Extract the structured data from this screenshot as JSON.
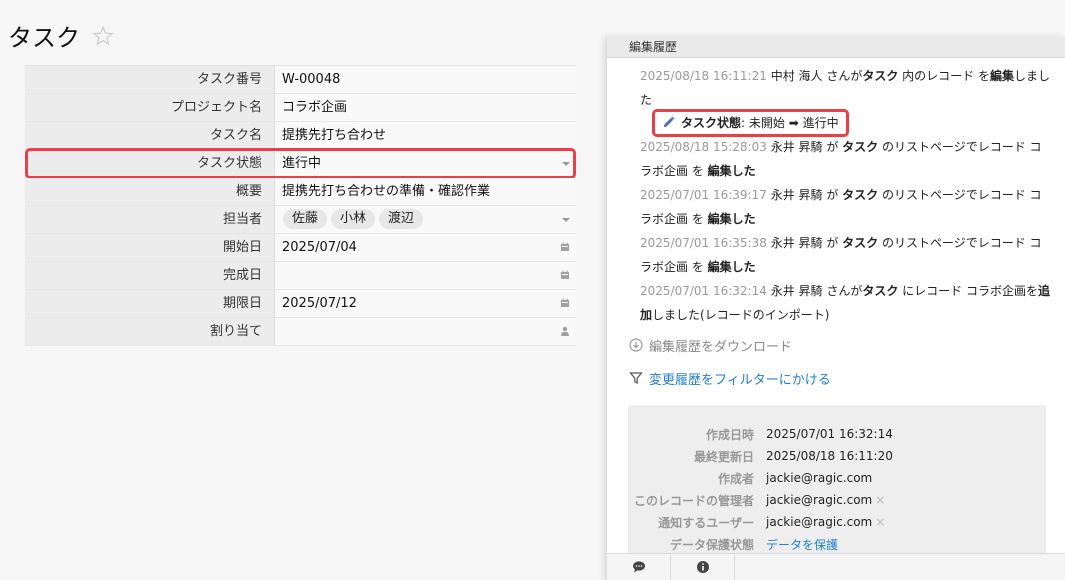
{
  "page": {
    "title": "タスク"
  },
  "form": {
    "rows": [
      {
        "label": "タスク番号",
        "value": "W-00048"
      },
      {
        "label": "プロジェクト名",
        "value": "コラボ企画"
      },
      {
        "label": "タスク名",
        "value": "提携先打ち合わせ"
      },
      {
        "label": "タスク状態",
        "value": "進行中"
      },
      {
        "label": "概要",
        "value": "提携先打ち合わせの準備・確認作業"
      },
      {
        "label": "担当者",
        "tags": [
          "佐藤",
          "小林",
          "渡辺"
        ]
      },
      {
        "label": "開始日",
        "value": "2025/07/04"
      },
      {
        "label": "完成日",
        "value": ""
      },
      {
        "label": "期限日",
        "value": "2025/07/12"
      },
      {
        "label": "割り当て",
        "value": ""
      }
    ]
  },
  "panel": {
    "header": "編集履歴",
    "history": [
      {
        "ts": "2025/08/18 16:11:21",
        "t1": "中村 海人 さんが",
        "b1": "タスク",
        "t2": " 内のレコード を",
        "b2": "編集",
        "t3": "しました"
      },
      {
        "ts": "2025/08/18 15:28:03",
        "t1": "永井 昇騎 が ",
        "b1": "タスク",
        "t2": " のリストページでレコード コラボ企画 を",
        "b2": "編集した",
        "t3": ""
      },
      {
        "ts": "2025/07/01 16:39:17",
        "t1": "永井 昇騎 が ",
        "b1": "タスク",
        "t2": " のリストページでレコード コラボ企画 を",
        "b2": "編集した",
        "t3": ""
      },
      {
        "ts": "2025/07/01 16:35:38",
        "t1": "永井 昇騎 が ",
        "b1": "タスク",
        "t2": " のリストページでレコード コラボ企画 を",
        "b2": "編集した",
        "t3": ""
      },
      {
        "ts": "2025/07/01 16:32:14",
        "t1": "永井 昇騎 さんが",
        "b1": "タスク",
        "t2": " にレコード コラボ企画を",
        "b2": "追加",
        "t3": "しました(レコードのインポート)"
      }
    ],
    "change": {
      "field": "タスク状態",
      "sep": ": ",
      "from": "未開始",
      "arrow": "➡",
      "to": "進行中"
    },
    "download_label": "編集履歴をダウンロード",
    "filter_label": "変更履歴をフィルターにかける",
    "meta": [
      {
        "label": "作成日時",
        "value": "2025/07/01 16:32:14"
      },
      {
        "label": "最終更新日",
        "value": "2025/08/18 16:11:20"
      },
      {
        "label": "作成者",
        "value": "jackie@ragic.com"
      },
      {
        "label": "このレコードの管理者",
        "value": "jackie@ragic.com",
        "x": "×"
      },
      {
        "label": "通知するユーザー",
        "value": "jackie@ragic.com",
        "x": "×"
      },
      {
        "label": "データ保護状態",
        "value": "データを保護"
      }
    ]
  },
  "colors": {
    "highlight": "#e8404a",
    "link": "#1f7fd0"
  }
}
